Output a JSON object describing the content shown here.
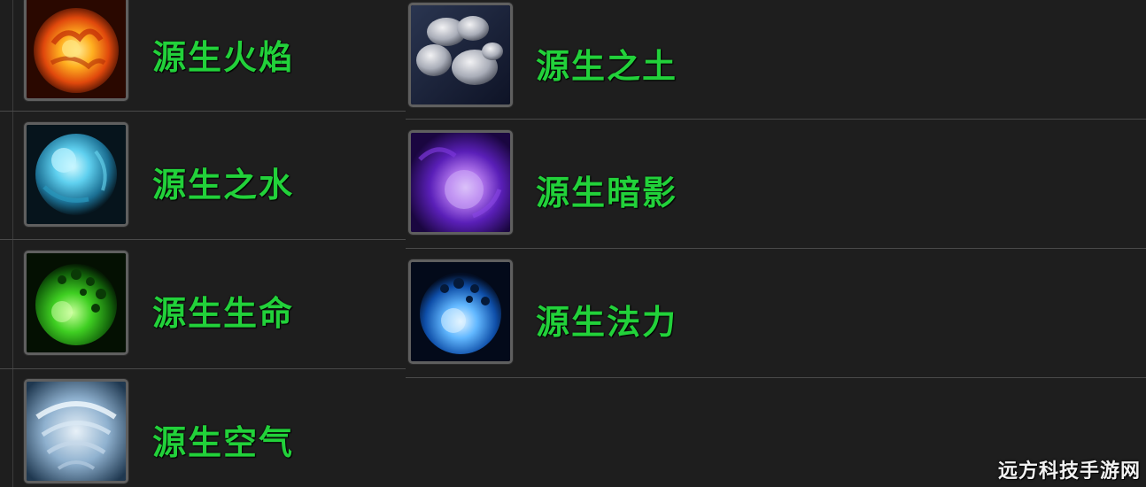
{
  "theme": {
    "label_color": "#22d13a",
    "background": "#1e1e1e",
    "watermark_color": "#f2f2f2"
  },
  "left_column": [
    {
      "name": "源生火焰",
      "icon": "fire-orb-icon"
    },
    {
      "name": "源生之水",
      "icon": "water-orb-icon"
    },
    {
      "name": "源生生命",
      "icon": "life-orb-icon"
    },
    {
      "name": "源生空气",
      "icon": "air-swirl-icon"
    }
  ],
  "right_column": [
    {
      "name": "源生之土",
      "icon": "earth-rocks-icon"
    },
    {
      "name": "源生暗影",
      "icon": "shadow-orb-icon"
    },
    {
      "name": "源生法力",
      "icon": "mana-orb-icon"
    }
  ],
  "watermark": "远方科技手游网"
}
